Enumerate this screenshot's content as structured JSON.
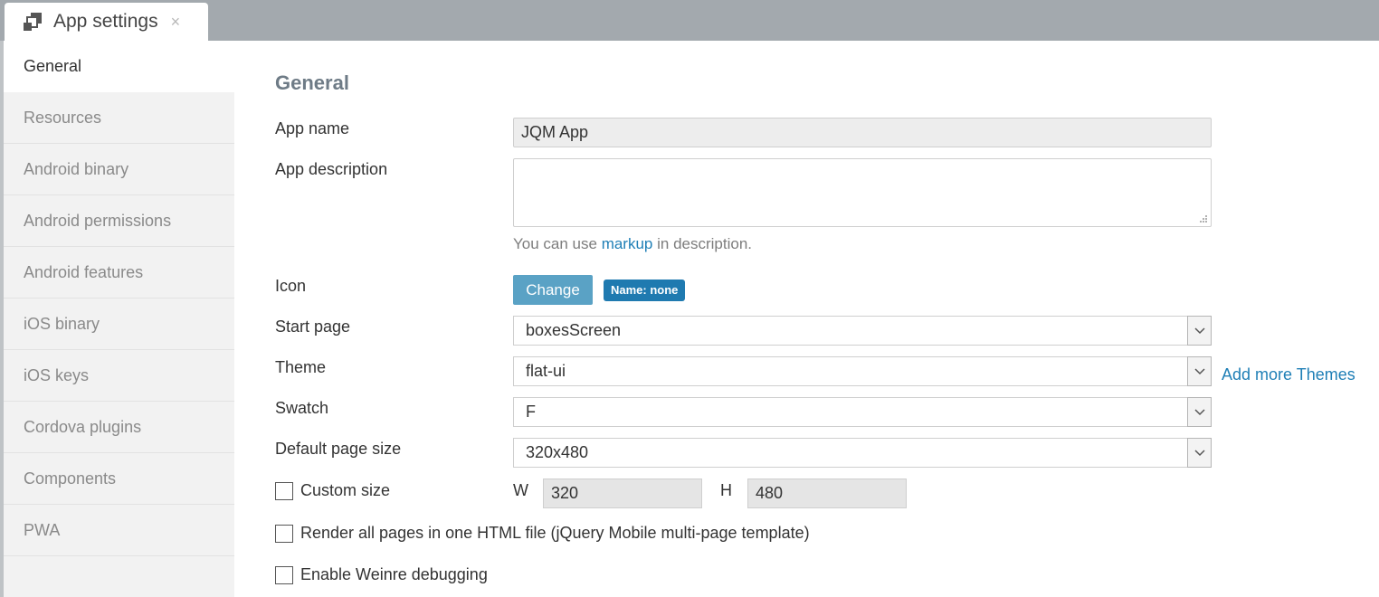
{
  "tab": {
    "icon": "app-settings-icon",
    "title": "App settings",
    "close": "×"
  },
  "sidebar": {
    "items": [
      {
        "label": "General",
        "active": true
      },
      {
        "label": "Resources"
      },
      {
        "label": "Android binary"
      },
      {
        "label": "Android permissions"
      },
      {
        "label": "Android features"
      },
      {
        "label": "iOS binary"
      },
      {
        "label": "iOS keys"
      },
      {
        "label": "Cordova plugins"
      },
      {
        "label": "Components"
      },
      {
        "label": "PWA"
      }
    ]
  },
  "main": {
    "heading": "General",
    "app_name": {
      "label": "App name",
      "value": "JQM App"
    },
    "app_description": {
      "label": "App description",
      "value": "",
      "hint_before": "You can use",
      "hint_link": "markup",
      "hint_after": "in description."
    },
    "icon": {
      "label": "Icon",
      "button": "Change",
      "badge": "Name: none"
    },
    "start_page": {
      "label": "Start page",
      "value": "boxesScreen"
    },
    "theme": {
      "label": "Theme",
      "value": "flat-ui",
      "link": "Add more Themes"
    },
    "swatch": {
      "label": "Swatch",
      "value": "F"
    },
    "default_page_size": {
      "label": "Default page size",
      "value": "320x480"
    },
    "custom_size": {
      "label": "Custom size",
      "checked": false,
      "w_label": "W",
      "w_value": "320",
      "h_label": "H",
      "h_value": "480"
    },
    "render_all": {
      "label": "Render all pages in one HTML file (jQuery Mobile multi-page template)",
      "checked": false
    },
    "weinre": {
      "label": "Enable Weinre debugging",
      "checked": false
    }
  },
  "colors": {
    "accent": "#1f7fb6",
    "button": "#5aa2c5",
    "badge": "#1f7ab0",
    "topbar": "#a3a9ae"
  }
}
